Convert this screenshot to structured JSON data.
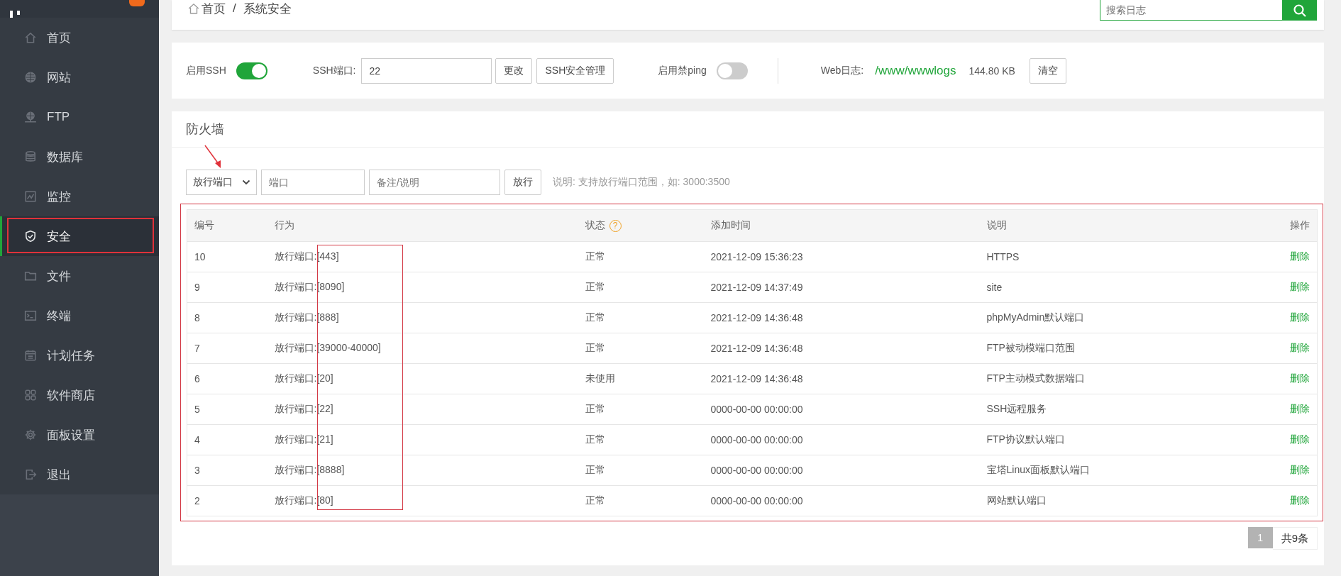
{
  "sidebar": {
    "items": [
      {
        "label": "首页",
        "selected": false
      },
      {
        "label": "网站",
        "selected": false
      },
      {
        "label": "FTP",
        "selected": false
      },
      {
        "label": "数据库",
        "selected": false
      },
      {
        "label": "监控",
        "selected": false
      },
      {
        "label": "安全",
        "selected": true
      },
      {
        "label": "文件",
        "selected": false
      },
      {
        "label": "终端",
        "selected": false
      },
      {
        "label": "计划任务",
        "selected": false
      },
      {
        "label": "软件商店",
        "selected": false
      },
      {
        "label": "面板设置",
        "selected": false
      },
      {
        "label": "退出",
        "selected": false
      }
    ]
  },
  "breadcrumb": {
    "items": [
      "首页",
      "系统安全"
    ],
    "separator": "/"
  },
  "search": {
    "placeholder": "搜索日志"
  },
  "settings": {
    "ssh_label": "启用SSH",
    "ssh_on": true,
    "port_label": "SSH端口:",
    "port_value": "22",
    "change_button": "更改",
    "manage_button": "SSH安全管理",
    "ping_label": "启用禁ping",
    "ping_on": false,
    "log_label": "Web日志:",
    "log_path": "/www/wwwlogs",
    "log_size": "144.80 KB",
    "clear_button": "清空"
  },
  "firewall": {
    "title": "防火墙",
    "select_value": "放行端口",
    "port_placeholder": "端口",
    "note_placeholder": "备注/说明",
    "submit_button": "放行",
    "hint": "说明: 支持放行端口范围，如: 3000:3500"
  },
  "table": {
    "columns": [
      "编号",
      "行为",
      "状态",
      "添加时间",
      "说明",
      "操作"
    ],
    "status_help": "?",
    "rows": [
      [
        "10",
        "放行端口:[443]",
        "正常",
        "2021-12-09 15:36:23",
        "HTTPS",
        "删除"
      ],
      [
        "9",
        "放行端口:[8090]",
        "正常",
        "2021-12-09 14:37:49",
        "site",
        "删除"
      ],
      [
        "8",
        "放行端口:[888]",
        "正常",
        "2021-12-09 14:36:48",
        "phpMyAdmin默认端口",
        "删除"
      ],
      [
        "7",
        "放行端口:[39000-40000]",
        "正常",
        "2021-12-09 14:36:48",
        "FTP被动模端口范围",
        "删除"
      ],
      [
        "6",
        "放行端口:[20]",
        "未使用",
        "2021-12-09 14:36:48",
        "FTP主动模式数据端口",
        "删除"
      ],
      [
        "5",
        "放行端口:[22]",
        "正常",
        "0000-00-00 00:00:00",
        "SSH远程服务",
        "删除"
      ],
      [
        "4",
        "放行端口:[21]",
        "正常",
        "0000-00-00 00:00:00",
        "FTP协议默认端口",
        "删除"
      ],
      [
        "3",
        "放行端口:[8888]",
        "正常",
        "0000-00-00 00:00:00",
        "宝塔Linux面板默认端口",
        "删除"
      ],
      [
        "2",
        "放行端口:[80]",
        "正常",
        "0000-00-00 00:00:00",
        "网站默认端口",
        "删除"
      ]
    ]
  },
  "pagination": {
    "pages": [
      {
        "label": "1",
        "selected": true
      }
    ],
    "total": "共9条"
  }
}
